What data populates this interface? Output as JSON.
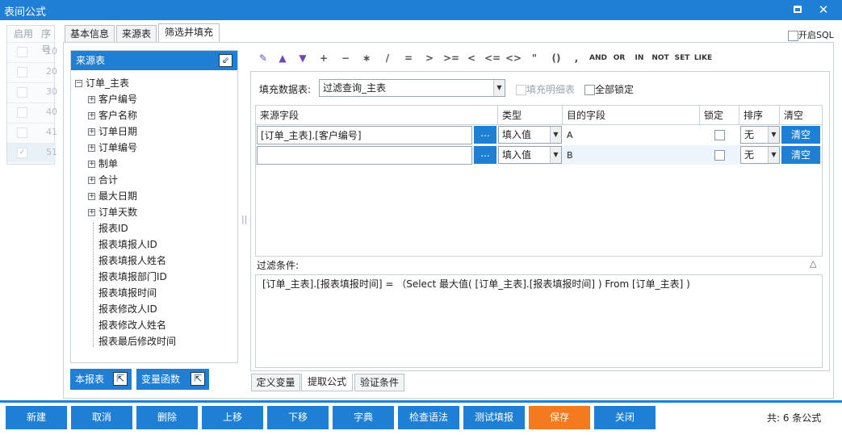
{
  "window": {
    "title": "表间公式"
  },
  "bg_grid": {
    "headers": [
      "启用",
      "序号"
    ],
    "rows": [
      "10",
      "20",
      "30",
      "40",
      "41",
      "51"
    ]
  },
  "tabs": {
    "basic": "基本信息",
    "source": "来源表",
    "filter_fill": "筛选并填充"
  },
  "enable_sql": "开启SQL",
  "source_tree": {
    "title": "来源表",
    "root": "订单_主表",
    "groups": [
      "客户编号",
      "客户名称",
      "订单日期",
      "订单编号",
      "制单",
      "合计",
      "最大日期",
      "订单天数"
    ],
    "fields": [
      "报表ID",
      "报表填报人ID",
      "报表填报人姓名",
      "报表填报部门ID",
      "报表填报时间",
      "报表修改人ID",
      "报表修改人姓名",
      "报表最后修改时间"
    ]
  },
  "side_buttons": {
    "this_report": "本报表",
    "var_func": "变量函数"
  },
  "toolbar": {
    "plus": "+",
    "minus": "−",
    "mul": "∗",
    "div": "/",
    "eq": "=",
    "gt": ">",
    "ge": ">=",
    "lt": "<",
    "le": "<=",
    "ne": "<>",
    "quote": "\"",
    "paren": "()",
    "comma": ",",
    "and": "AND",
    "or": "OR",
    "in": "IN",
    "not": "NOT",
    "set": "SET",
    "like": "LIKE"
  },
  "fill_form": {
    "fill_table_label": "填充数据表:",
    "fill_table_value": "过滤查询_主表",
    "fill_detail": "填充明细表",
    "lock_all": "全部锁定"
  },
  "mapping_grid": {
    "headers": {
      "source": "来源字段",
      "type": "类型",
      "target": "目的字段",
      "lock": "锁定",
      "sort": "排序",
      "clear": "清空"
    },
    "rows": [
      {
        "source": "[订单_主表].[客户编号]",
        "dots": "...",
        "type": "填入值",
        "target": "A",
        "sort": "无",
        "clear": "清空"
      },
      {
        "source": "",
        "dots": "...",
        "type": "填入值",
        "target": "B",
        "sort": "无",
        "clear": "清空"
      }
    ]
  },
  "filter": {
    "label": "过滤条件:",
    "toggle": "△",
    "expression": "[订单_主表].[报表填报时间] = （Select  最大值( [订单_主表].[报表填报时间] ) From  [订单_主表] )"
  },
  "bottom_tabs": {
    "define_var": "定义变量",
    "extract": "提取公式",
    "validate": "验证条件"
  },
  "actions": {
    "new": "新建",
    "cancel": "取消",
    "delete": "删除",
    "up": "上移",
    "down": "下移",
    "dict": "字典",
    "check": "检查语法",
    "test": "测试填报",
    "save": "保存",
    "close": "关闭"
  },
  "footer": {
    "count_text": "共: 6 条公式"
  },
  "colors": {
    "accent": "#1f7fd4",
    "save": "#f47a20"
  }
}
